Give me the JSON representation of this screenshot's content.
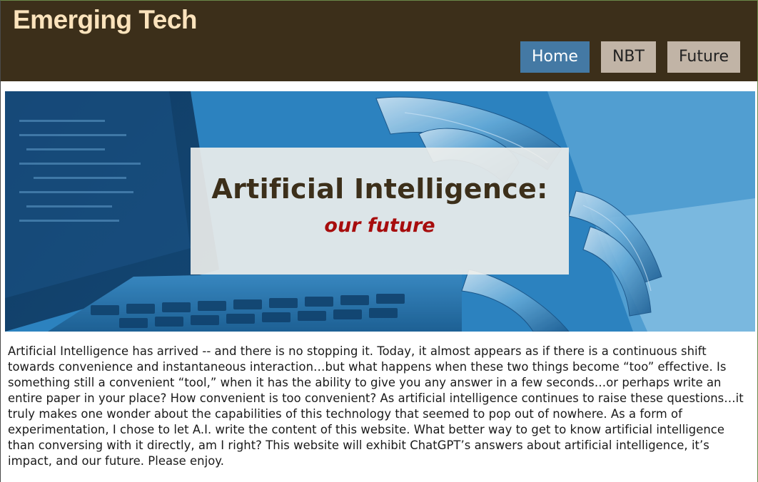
{
  "site": {
    "title": "Emerging Tech"
  },
  "nav": {
    "items": [
      {
        "label": "Home",
        "active": true
      },
      {
        "label": "NBT",
        "active": false
      },
      {
        "label": "Future",
        "active": false
      }
    ]
  },
  "hero": {
    "title": "Artificial Intelligence:",
    "subtitle": "our future"
  },
  "content": {
    "intro": "Artificial Intelligence has arrived -- and there is no stopping it. Today, it almost appears as if there is a continuous shift towards convenience and instantaneous interaction…but what happens when these two things become “too” effective. Is something still a convenient “tool,” when it has the ability to give you any answer in a few seconds…or perhaps write an entire paper in your place? How convenient is too convenient? As artificial intelligence continues to raise these questions…it truly makes one wonder about the capabilities of this technology that seemed to pop out of nowhere. As a form of experimentation, I chose to let A.I. write the content of this website. What better way to get to know artificial intelligence than conversing with it directly, am I right? This website will exhibit ChatGPT’s answers about artificial intelligence, it’s impact, and our future. Please enjoy."
  },
  "colors": {
    "header_bg": "#3c2f1a",
    "title_text": "#fbe3bc",
    "nav_active": "#4479a4",
    "nav_inactive": "#c1b4a6",
    "hero_title": "#3c2f1a",
    "hero_subtitle": "#a70d0d"
  }
}
